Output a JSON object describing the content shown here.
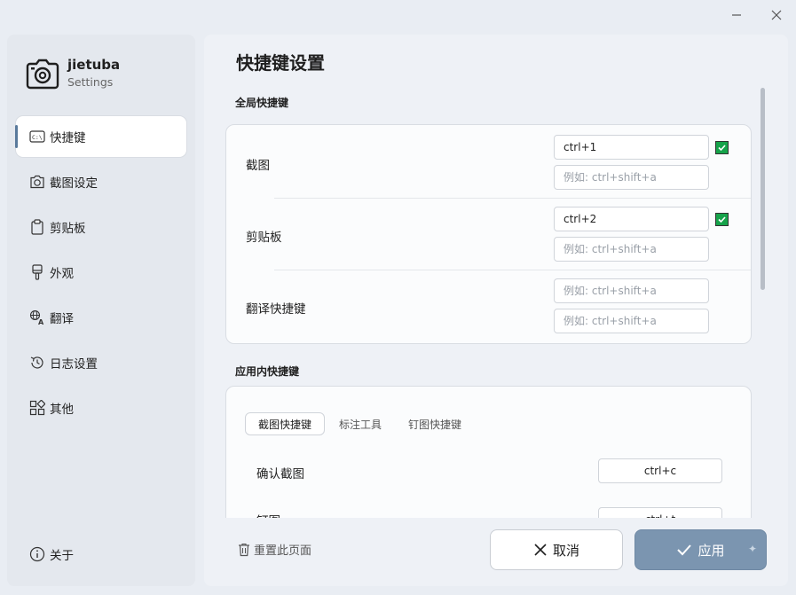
{
  "app": {
    "name": "jietuba",
    "subtitle": "Settings"
  },
  "sidebar": {
    "items": [
      {
        "label": "快捷键",
        "icon": "keyboard-icon"
      },
      {
        "label": "截图设定",
        "icon": "camera-icon"
      },
      {
        "label": "剪贴板",
        "icon": "clipboard-icon"
      },
      {
        "label": "外观",
        "icon": "brush-icon"
      },
      {
        "label": "翻译",
        "icon": "translate-icon"
      },
      {
        "label": "日志设置",
        "icon": "history-icon"
      },
      {
        "label": "其他",
        "icon": "apps-icon"
      }
    ],
    "about": {
      "label": "关于",
      "icon": "info-icon"
    }
  },
  "main": {
    "title": "快捷键设置",
    "global_section": {
      "label": "全局快捷键",
      "rows": [
        {
          "label": "截图",
          "primary": "ctrl+1",
          "secondary_placeholder": "例如: ctrl+shift+a",
          "enabled": true
        },
        {
          "label": "剪贴板",
          "primary": "ctrl+2",
          "secondary_placeholder": "例如: ctrl+shift+a",
          "enabled": true
        },
        {
          "label": "翻译快捷键",
          "primary_placeholder": "例如: ctrl+shift+a",
          "secondary_placeholder": "例如: ctrl+shift+a"
        }
      ]
    },
    "app_section": {
      "label": "应用内快捷键",
      "tabs": [
        "截图快捷键",
        "标注工具",
        "钉图快捷键"
      ],
      "active_tab": 0,
      "rows": [
        {
          "label": "确认截图",
          "value": "ctrl+c"
        },
        {
          "label": "钉图",
          "value": "ctrl+t"
        }
      ]
    }
  },
  "footer": {
    "reset_label": "重置此页面",
    "cancel_label": "取消",
    "apply_label": "应用"
  },
  "colors": {
    "accent": "#5a7a9b",
    "apply_bg": "#7b95b0",
    "check_green": "#16a34a"
  }
}
